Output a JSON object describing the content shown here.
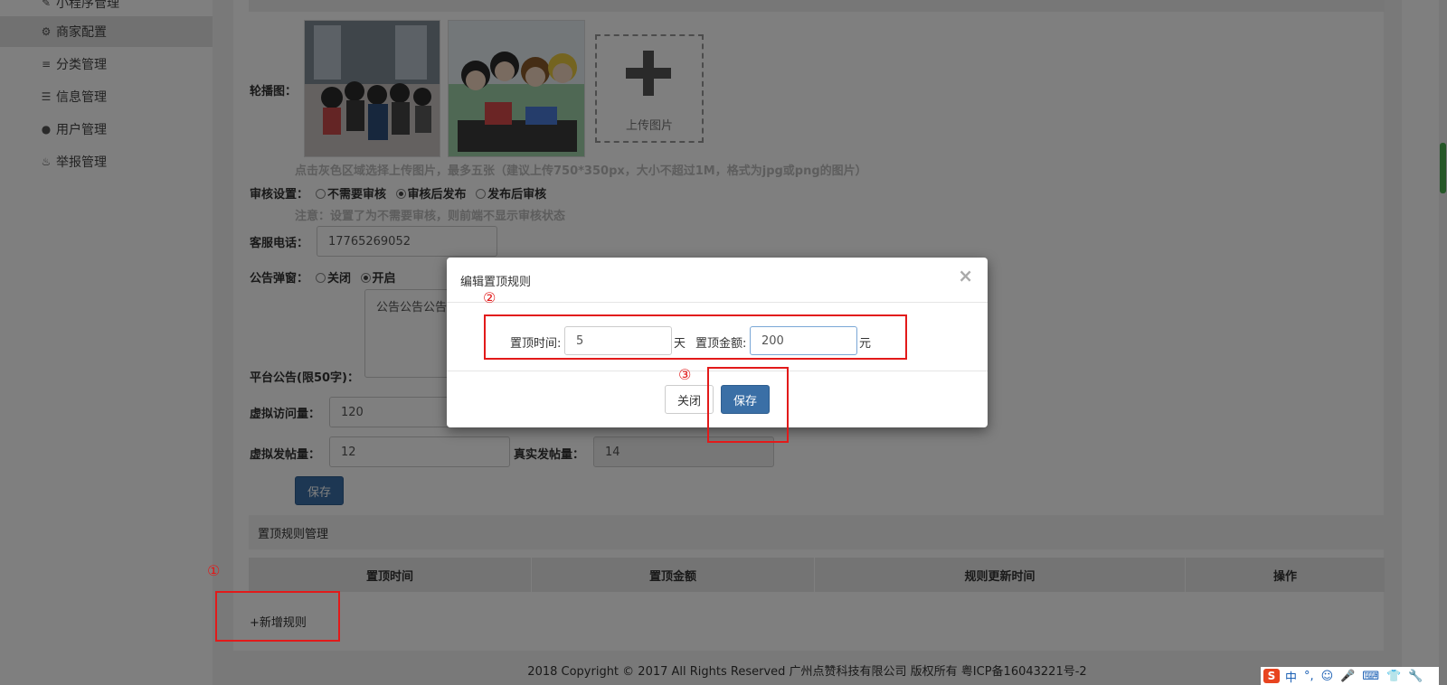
{
  "sidebar": {
    "items": [
      {
        "label": "小程序管理",
        "icon": "pencil-icon"
      },
      {
        "label": "商家配置",
        "icon": "gear-icon"
      },
      {
        "label": "分类管理",
        "icon": "align-left-icon"
      },
      {
        "label": "信息管理",
        "icon": "list-icon"
      },
      {
        "label": "用户管理",
        "icon": "user-icon"
      },
      {
        "label": "举报管理",
        "icon": "fire-icon"
      }
    ]
  },
  "form": {
    "carousel_label": "轮播图：",
    "upload_label": "上传图片",
    "carousel_hint": "点击灰色区域选择上传图片，最多五张（建议上传750*350px，大小不超过1M，格式为jpg或png的图片）",
    "review_label": "审核设置：",
    "review_options": [
      "不需要审核",
      "审核后发布",
      "发布后审核"
    ],
    "review_note": "注意：设置了为不需要审核，则前端不显示审核状态",
    "phone_label": "客服电话：",
    "phone_value": "17765269052",
    "popup_label": "公告弹窗：",
    "popup_options": [
      "关闭",
      "开启"
    ],
    "notice_label": "平台公告(限50字)：",
    "notice_value": "公告公告公告",
    "visits_label": "虚拟访问量：",
    "visits_value": "120",
    "posts_label": "虚拟发帖量：",
    "posts_value": "12",
    "real_posts_label": "真实发帖量：",
    "real_posts_value": "14",
    "save_label": "保存"
  },
  "rules": {
    "section_title": "置顶规则管理",
    "columns": [
      "置顶时间",
      "置顶金额",
      "规则更新时间",
      "操作"
    ],
    "add_label": "+新增规则"
  },
  "footer": {
    "text": "2018 Copyright © 2017 All Rights Reserved 广州点赞科技有限公司 版权所有 粤ICP备16043221号-2"
  },
  "modal": {
    "title": "编辑置顶规则",
    "close_glyph": "×",
    "time_label": "置顶时间:",
    "time_value": "5",
    "time_unit": "天",
    "amount_label": "置顶金额:",
    "amount_value": "200",
    "amount_unit": "元",
    "close_button": "关闭",
    "save_button": "保存"
  },
  "annotations": {
    "step1": "①",
    "step2": "②",
    "step3": "③",
    "color": "#e21a1a"
  },
  "ime": {
    "logo": "S",
    "items": [
      "中",
      "°,",
      "☺",
      "🎤",
      "⌨",
      "👕",
      "🔧"
    ]
  }
}
